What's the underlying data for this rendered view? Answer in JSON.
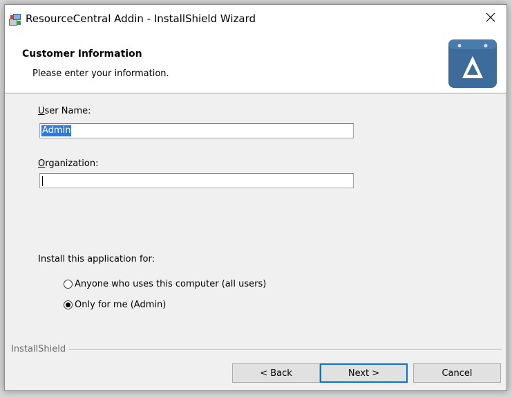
{
  "window": {
    "title": "ResourceCentral Addin - InstallShield Wizard",
    "close_glyph": "✕"
  },
  "header": {
    "title": "Customer Information",
    "subtitle": "Please enter your information.",
    "logo_icon": "delta-logo-icon",
    "logo_color": "#3d6b9a"
  },
  "form": {
    "user_name_label_hotkey": "U",
    "user_name_label_rest": "ser Name:",
    "user_name_value": "Admin",
    "organization_label_hotkey": "O",
    "organization_label_rest": "rganization:",
    "organization_value": ""
  },
  "install_for": {
    "label": "Install this application for:",
    "options": [
      {
        "label": "Anyone who uses this computer (all users)",
        "selected": false
      },
      {
        "label": "Only for me (Admin)",
        "selected": true
      }
    ]
  },
  "footer": {
    "brand": "InstallShield",
    "back_label": "< Back",
    "next_label": "Next >",
    "cancel_label": "Cancel"
  }
}
